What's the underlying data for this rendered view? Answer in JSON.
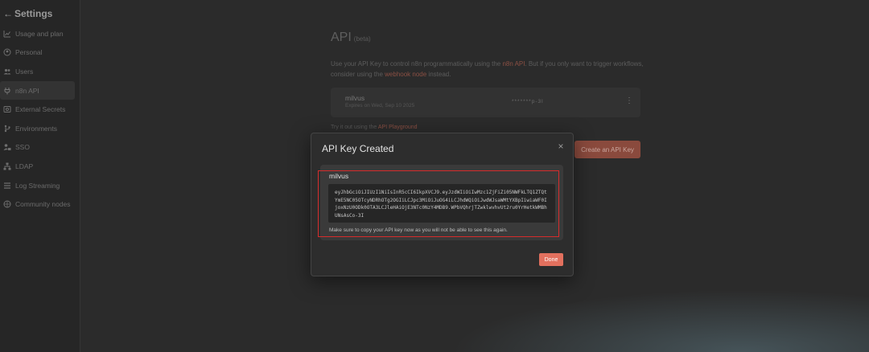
{
  "sidebar": {
    "title": "Settings",
    "back_icon": "←",
    "items": [
      {
        "label": "Usage and plan",
        "icon": "chart-icon"
      },
      {
        "label": "Personal",
        "icon": "user-circle-icon"
      },
      {
        "label": "Users",
        "icon": "users-icon"
      },
      {
        "label": "n8n API",
        "icon": "plug-icon",
        "active": true
      },
      {
        "label": "External Secrets",
        "icon": "vault-icon"
      },
      {
        "label": "Environments",
        "icon": "branch-icon"
      },
      {
        "label": "SSO",
        "icon": "user-lock-icon"
      },
      {
        "label": "LDAP",
        "icon": "network-icon"
      },
      {
        "label": "Log Streaming",
        "icon": "list-icon"
      },
      {
        "label": "Community nodes",
        "icon": "cube-icon"
      }
    ]
  },
  "main": {
    "title": "API",
    "beta": "(beta)",
    "description_prefix": "Use your API Key to control n8n programmatically using the ",
    "api_link": "n8n API",
    "description_middle": ". But if you only want to trigger workflows, consider using the ",
    "webhook_link": "webhook node",
    "description_suffix": " instead.",
    "key_card": {
      "name": "milvus",
      "expires": "Expires on Wed, Sep 10 2025",
      "masked": "*******p-3l"
    },
    "try_prefix": "Try it out using the ",
    "playground_link": "API Playground",
    "create_button": "Create an API Key"
  },
  "modal": {
    "title": "API Key Created",
    "close_glyph": "×",
    "key_name": "milvus",
    "api_key": "eyJhbGciOiJIUzI1NiIsInR5cCI6IkpXVCJ9.eyJzdWIiOiIwMzc1ZjFiZi05NWFkLTQ1ZTQtYmE5NC05OTcyNDRhOTg2OGIiLCJpc3MiOiJuOG4iLCJhdWQiOiJwdWJsaWMtYXBpIiwiaWF0IjoxNzU0ODk0OTA3LCJleHAiOjE3NTc0NzY4MDB9.WPbVQhrjTZwklwvhvUt2ru0YrHetkWMBhUNsAsCo-3I",
    "note": "Make sure to copy your API key now as you will not be able to see this again.",
    "done_button": "Done"
  },
  "colors": {
    "accent": "#e2705e",
    "highlight": "#d62c2c"
  }
}
